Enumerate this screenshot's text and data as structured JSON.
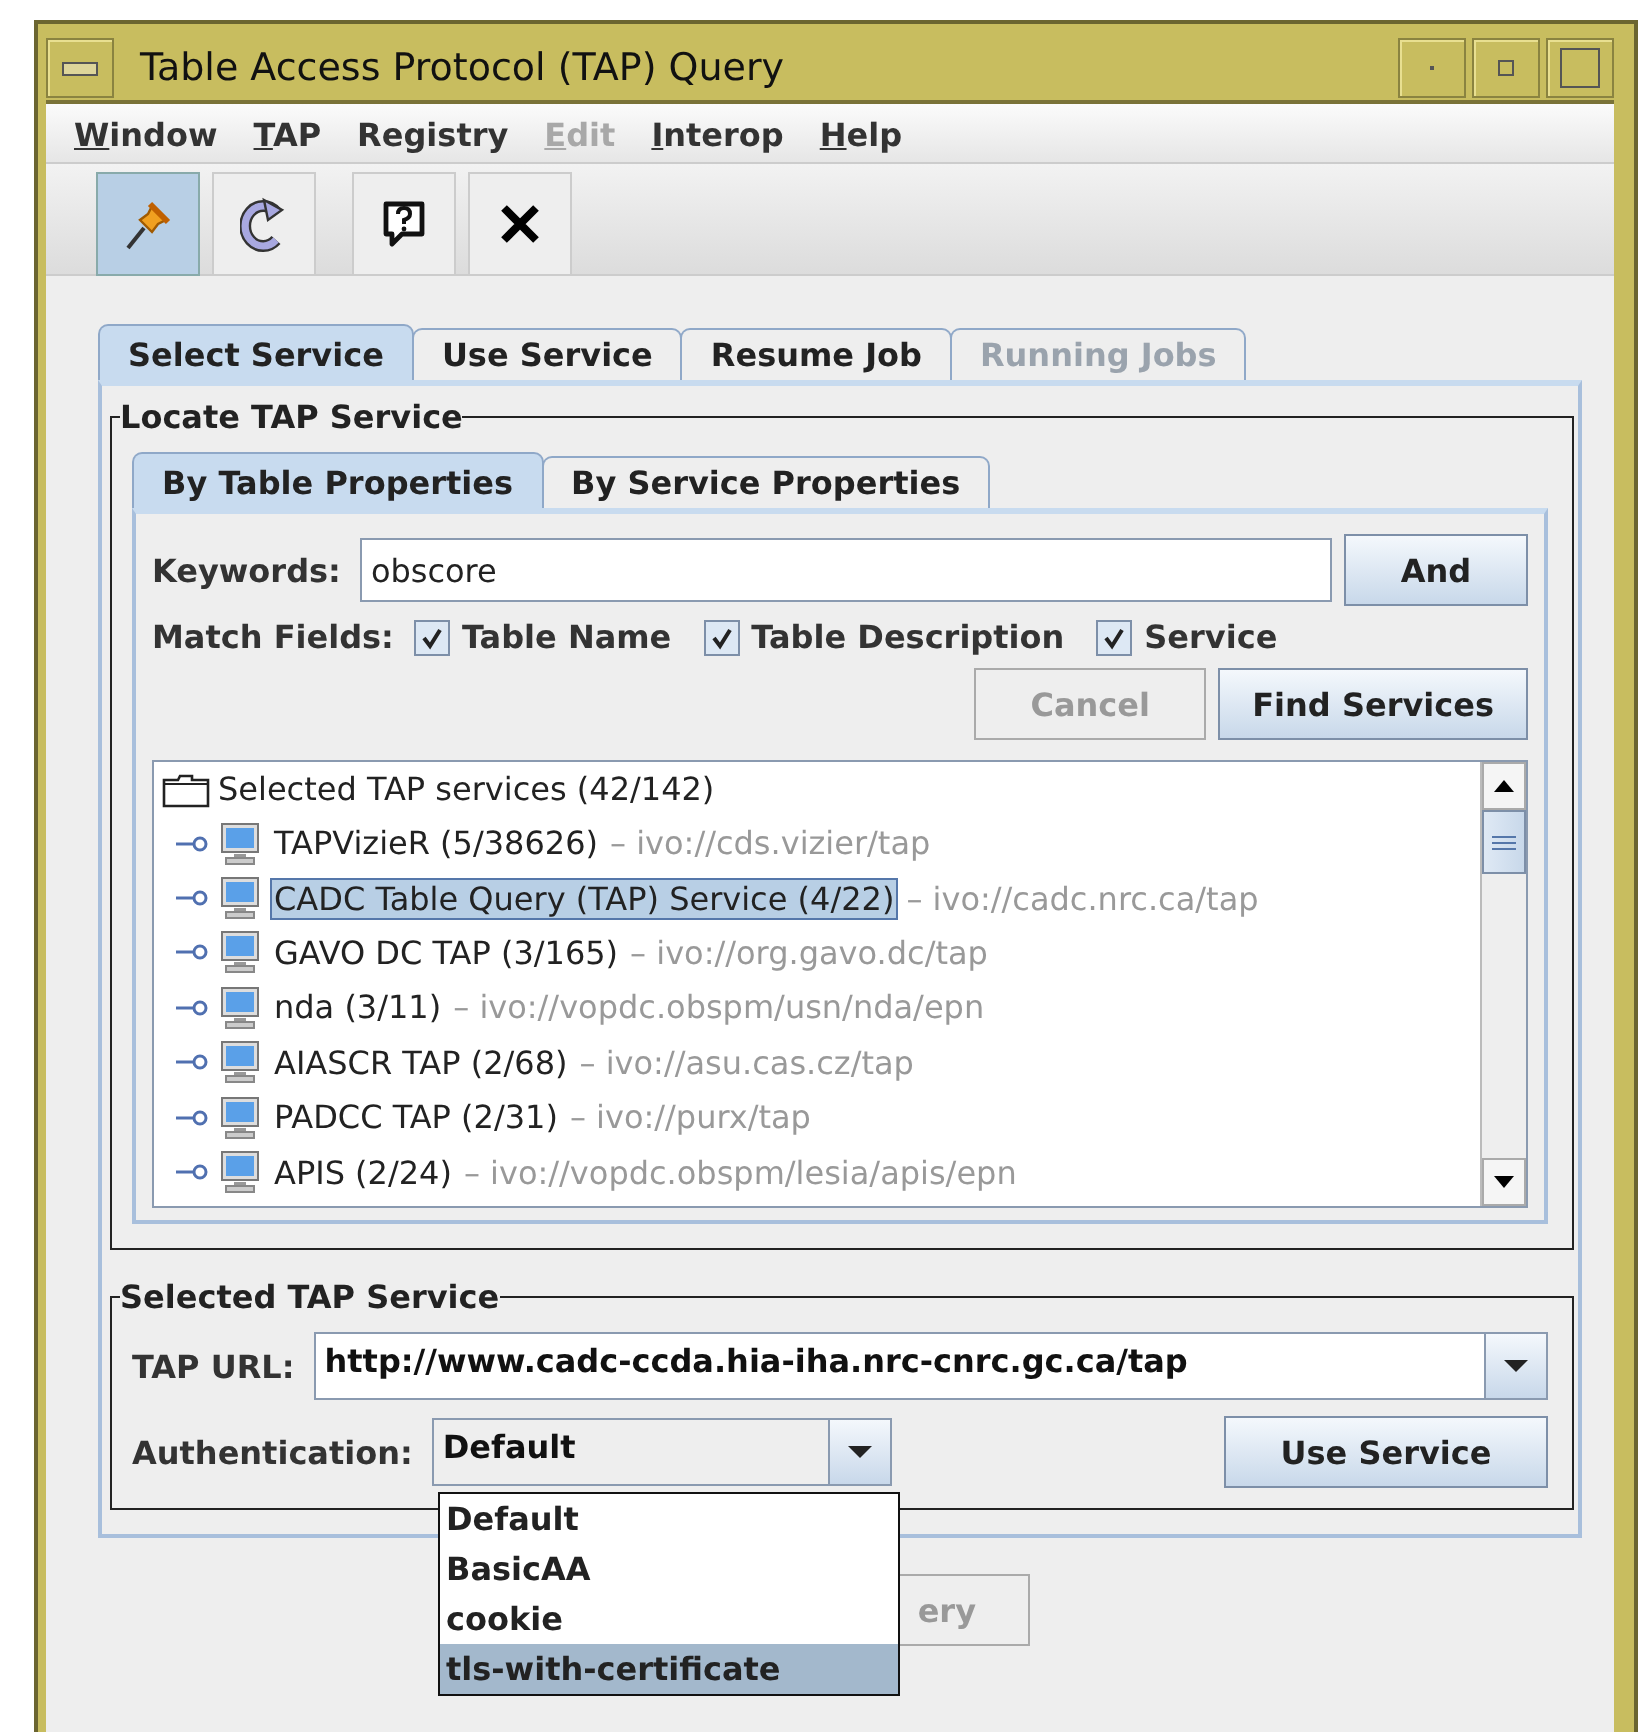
{
  "window": {
    "title": "Table Access Protocol (TAP) Query"
  },
  "menu": [
    {
      "label": "Window",
      "mnemonic": true,
      "disabled": false
    },
    {
      "label": "TAP",
      "mnemonic": true,
      "disabled": false
    },
    {
      "label": "Registry",
      "mnemonic": false,
      "disabled": false
    },
    {
      "label": "Edit",
      "mnemonic": true,
      "disabled": true
    },
    {
      "label": "Interop",
      "mnemonic": true,
      "disabled": false
    },
    {
      "label": "Help",
      "mnemonic": true,
      "disabled": false
    }
  ],
  "toolbar": [
    {
      "kind": "pin",
      "pressed": true
    },
    {
      "kind": "reload",
      "pressed": false
    },
    {
      "kind": "help",
      "pressed": false
    },
    {
      "kind": "close",
      "pressed": false
    }
  ],
  "tabs": [
    {
      "label": "Select Service",
      "selected": true,
      "disabled": false
    },
    {
      "label": "Use Service",
      "selected": false,
      "disabled": false
    },
    {
      "label": "Resume Job",
      "selected": false,
      "disabled": false
    },
    {
      "label": "Running Jobs",
      "selected": false,
      "disabled": true
    }
  ],
  "locate": {
    "title": "Locate TAP Service",
    "tabs": [
      {
        "label": "By Table Properties",
        "selected": true
      },
      {
        "label": "By Service Properties",
        "selected": false
      }
    ],
    "keywords_label": "Keywords:",
    "keywords": "obscore",
    "and_button": "And",
    "match_label": "Match Fields:",
    "match_fields": [
      {
        "label": "Table Name",
        "checked": true
      },
      {
        "label": "Table Description",
        "checked": true
      },
      {
        "label": "Service",
        "checked": true
      }
    ],
    "buttons": [
      {
        "label": "Cancel",
        "disabled": true
      },
      {
        "label": "Find Services",
        "disabled": false
      }
    ],
    "tree": {
      "root": "Selected TAP services (42/142)",
      "children": [
        {
          "name": "TAPVizieR (5/38626)",
          "uri": "– ivo://cds.vizier/tap",
          "selected": false
        },
        {
          "name": "CADC Table Query (TAP) Service (4/22)",
          "uri": "– ivo://cadc.nrc.ca/tap",
          "selected": true
        },
        {
          "name": "GAVO DC TAP (3/165)",
          "uri": "– ivo://org.gavo.dc/tap",
          "selected": false
        },
        {
          "name": "nda (3/11)",
          "uri": "– ivo://vopdc.obspm/usn/nda/epn",
          "selected": false
        },
        {
          "name": "AIASCR TAP (2/68)",
          "uri": "– ivo://asu.cas.cz/tap",
          "selected": false
        },
        {
          "name": "PADCC TAP (2/31)",
          "uri": "– ivo://purx/tap",
          "selected": false
        },
        {
          "name": "APIS (2/24)",
          "uri": "– ivo://vopdc.obspm/lesia/apis/epn",
          "selected": false
        }
      ]
    }
  },
  "selected_service": {
    "title": "Selected TAP Service",
    "url_label": "TAP URL:",
    "url": "http://www.cadc-ccda.hia-iha.nrc-cnrc.gc.ca/tap",
    "auth_label": "Authentication:",
    "auth": "Default",
    "use_button": "Use Service",
    "auth_options": [
      {
        "label": "Default",
        "selected": false
      },
      {
        "label": "BasicAA",
        "selected": false
      },
      {
        "label": "cookie",
        "selected": false
      },
      {
        "label": "tls-with-certificate",
        "selected": true
      }
    ]
  },
  "bottom_button": {
    "label": "ery",
    "disabled": true
  }
}
